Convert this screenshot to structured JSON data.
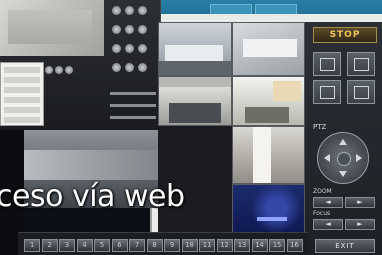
{
  "caption": "ceso vía web",
  "controls": {
    "stop_label": "STOP",
    "ptz_label": "PTZ",
    "zoom_label": "ZOOM",
    "focus_label": "Focus",
    "exit_label": "EXIT",
    "minus": "◄",
    "plus": "►"
  },
  "channels": [
    "1",
    "2",
    "3",
    "4",
    "5",
    "6",
    "7",
    "8",
    "9",
    "10",
    "11",
    "12",
    "13",
    "14",
    "15",
    "16"
  ],
  "colors": {
    "accent": "#f0c25a",
    "window_bg": "#e9ece9",
    "panel_bg": "#1d2126",
    "titlebar": "#2a7fa7"
  }
}
